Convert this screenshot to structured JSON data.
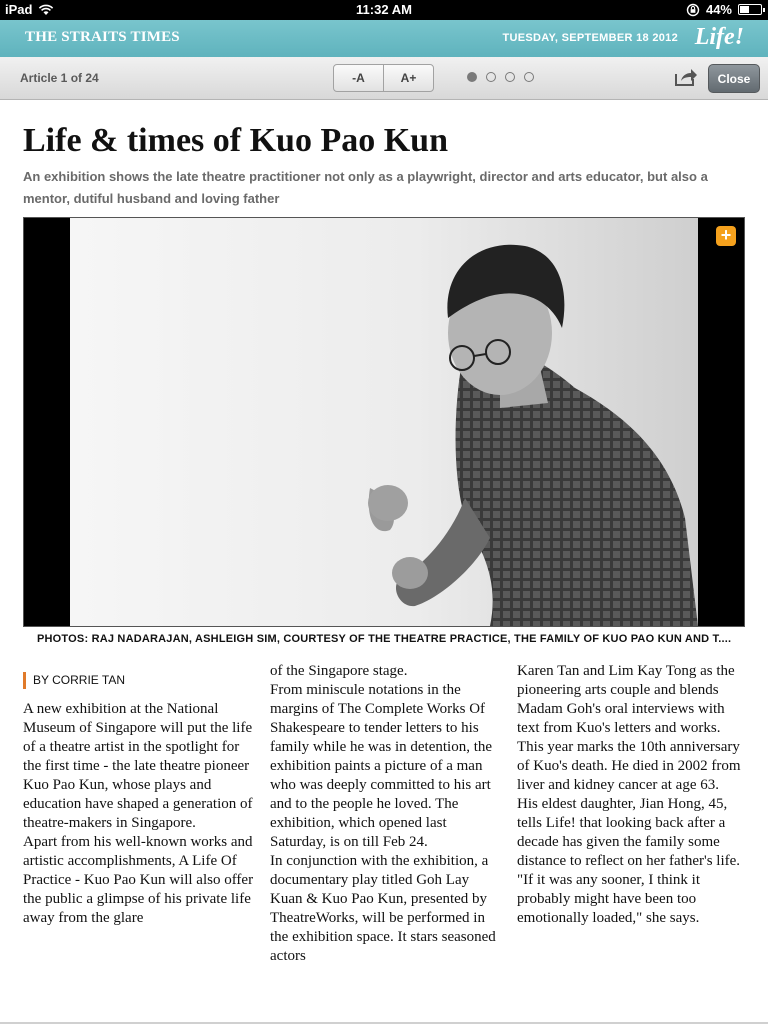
{
  "status_bar": {
    "device": "iPad",
    "time": "11:32 AM",
    "battery": "44%",
    "battery_level": 0.44
  },
  "masthead": {
    "paper": "THE STRAITS TIMES",
    "date": "TUESDAY, SEPTEMBER 18 2012",
    "brand": "Life!"
  },
  "toolbar": {
    "counter": "Article 1 of 24",
    "font_decrease": "-A",
    "font_increase": "A+",
    "pages": 4,
    "active_page": 1,
    "close": "Close"
  },
  "article": {
    "headline": "Life & times of Kuo Pao Kun",
    "standfirst": "An exhibition shows the late theatre practitioner not only as a playwright, director and arts educator, but also a mentor, dutiful husband and loving father",
    "caption": "PHOTOS: RAJ NADARAJAN, ASHLEIGH SIM, COURTESY OF THE THEATRE PRACTICE, THE FAMILY OF KUO PAO KUN AND T....",
    "expand_label": "+",
    "byline": "BY CORRIE TAN",
    "col1": [
      "A new exhibition at the National Museum of Singapore will put the life of a theatre artist in the spotlight for the first time - the late theatre pioneer Kuo Pao Kun, whose plays and education have shaped a generation of theatre-makers in Singapore.",
      " Apart from his well-known works and artistic accomplishments, A Life Of Practice - Kuo Pao Kun will also offer the public a glimpse of his private life away from the glare"
    ],
    "col2": [
      "of the Singapore stage.",
      " From miniscule notations in the margins of The Complete Works Of Shakespeare to tender letters to his family while he was in detention, the exhibition paints a picture of a man who was deeply committed to his art and to the people he loved. The exhibition, which opened last Saturday, is on till Feb 24.",
      " In conjunction with the exhibition, a documentary play titled Goh Lay Kuan & Kuo Pao Kun, presented by TheatreWorks, will be performed in the exhibition space. It stars seasoned actors"
    ],
    "col3": [
      "Karen Tan and Lim Kay Tong as the pioneering arts couple and blends Madam Goh's oral interviews with text from Kuo's letters and works.",
      " This year marks the 10th anniversary of Kuo's death. He died in 2002 from liver and kidney cancer at age 63.",
      " His eldest daughter, Jian Hong, 45, tells Life! that looking back after a decade has given the family some distance to reflect on her father's life.",
      "\"If it was any sooner, I think it probably might have been too emotionally loaded,\" she says."
    ]
  }
}
